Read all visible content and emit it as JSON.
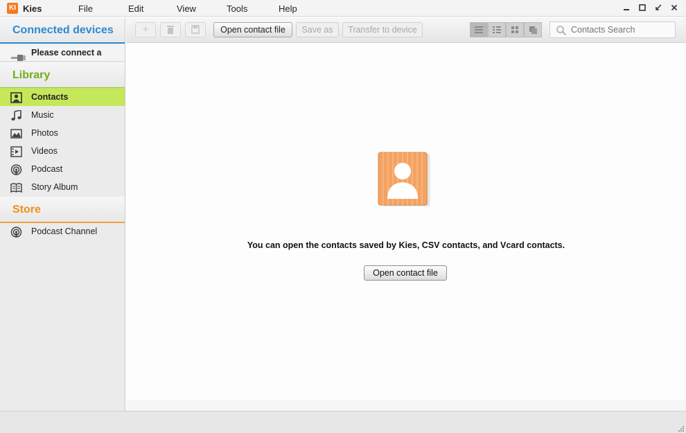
{
  "app": {
    "logo_text": "KI",
    "name": "Kies",
    "brand_color": "#f47b1f"
  },
  "menu": {
    "items": [
      {
        "label": "File"
      },
      {
        "label": "Edit"
      },
      {
        "label": "View"
      },
      {
        "label": "Tools"
      },
      {
        "label": "Help"
      }
    ]
  },
  "window_controls": {
    "minimize_icon": "minimize-icon",
    "maximize_icon": "maximize-icon",
    "restore_icon": "restore-icon",
    "close_icon": "close-icon"
  },
  "sidebar": {
    "connected_devices": {
      "header": "Connected devices",
      "color": "#2a8ad4",
      "device_label": "Please connect a dev..."
    },
    "library": {
      "header": "Library",
      "color": "#6fae1a",
      "items": [
        {
          "label": "Contacts",
          "icon": "contact-card-icon",
          "selected": true
        },
        {
          "label": "Music",
          "icon": "music-note-icon",
          "selected": false
        },
        {
          "label": "Photos",
          "icon": "photo-icon",
          "selected": false
        },
        {
          "label": "Videos",
          "icon": "film-icon",
          "selected": false
        },
        {
          "label": "Podcast",
          "icon": "podcast-icon",
          "selected": false
        },
        {
          "label": "Story Album",
          "icon": "book-icon",
          "selected": false
        }
      ]
    },
    "store": {
      "header": "Store",
      "color": "#f08c1e",
      "items": [
        {
          "label": "Podcast Channel",
          "icon": "podcast-icon"
        }
      ]
    },
    "selected_color": "#c5e85a"
  },
  "toolbar": {
    "add_icon": "add-icon",
    "delete_icon": "trash-icon",
    "save_icon": "save-icon",
    "open_contact_file": "Open contact file",
    "save_as": "Save as",
    "transfer_to_device": "Transfer to device",
    "view_modes": [
      "list-view-icon",
      "detail-list-view-icon",
      "grid-view-icon",
      "card-view-icon"
    ],
    "search": {
      "placeholder": "Contacts Search",
      "icon": "search-icon"
    }
  },
  "main": {
    "illustration_icon": "contact-book-icon",
    "message": "You can open the contacts saved by Kies, CSV contacts, and Vcard contacts.",
    "open_button": "Open contact file"
  }
}
